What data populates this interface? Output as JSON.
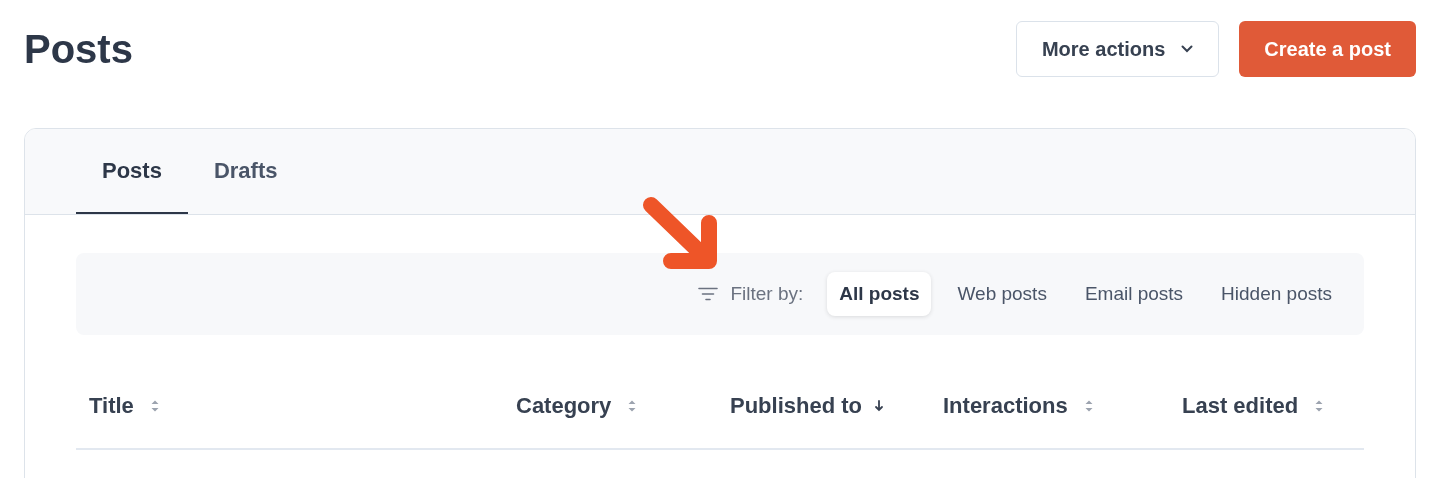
{
  "page": {
    "title": "Posts"
  },
  "header_actions": [
    {
      "label": "More actions",
      "kind": "menu"
    },
    {
      "label": "Create a post",
      "kind": "primary"
    }
  ],
  "tabs": [
    {
      "label": "Posts",
      "selected": true
    },
    {
      "label": "Drafts",
      "selected": false
    }
  ],
  "filter": {
    "label": "Filter by:",
    "options": [
      {
        "label": "All posts",
        "selected": true
      },
      {
        "label": "Web posts",
        "selected": false
      },
      {
        "label": "Email posts",
        "selected": false
      },
      {
        "label": "Hidden posts",
        "selected": false
      }
    ]
  },
  "table": {
    "columns": [
      {
        "label": "Title",
        "sorted": false
      },
      {
        "label": "Category",
        "sorted": false
      },
      {
        "label": "Published to",
        "sorted": true
      },
      {
        "label": "Interactions",
        "sorted": false
      },
      {
        "label": "Last edited",
        "sorted": false
      }
    ]
  }
}
